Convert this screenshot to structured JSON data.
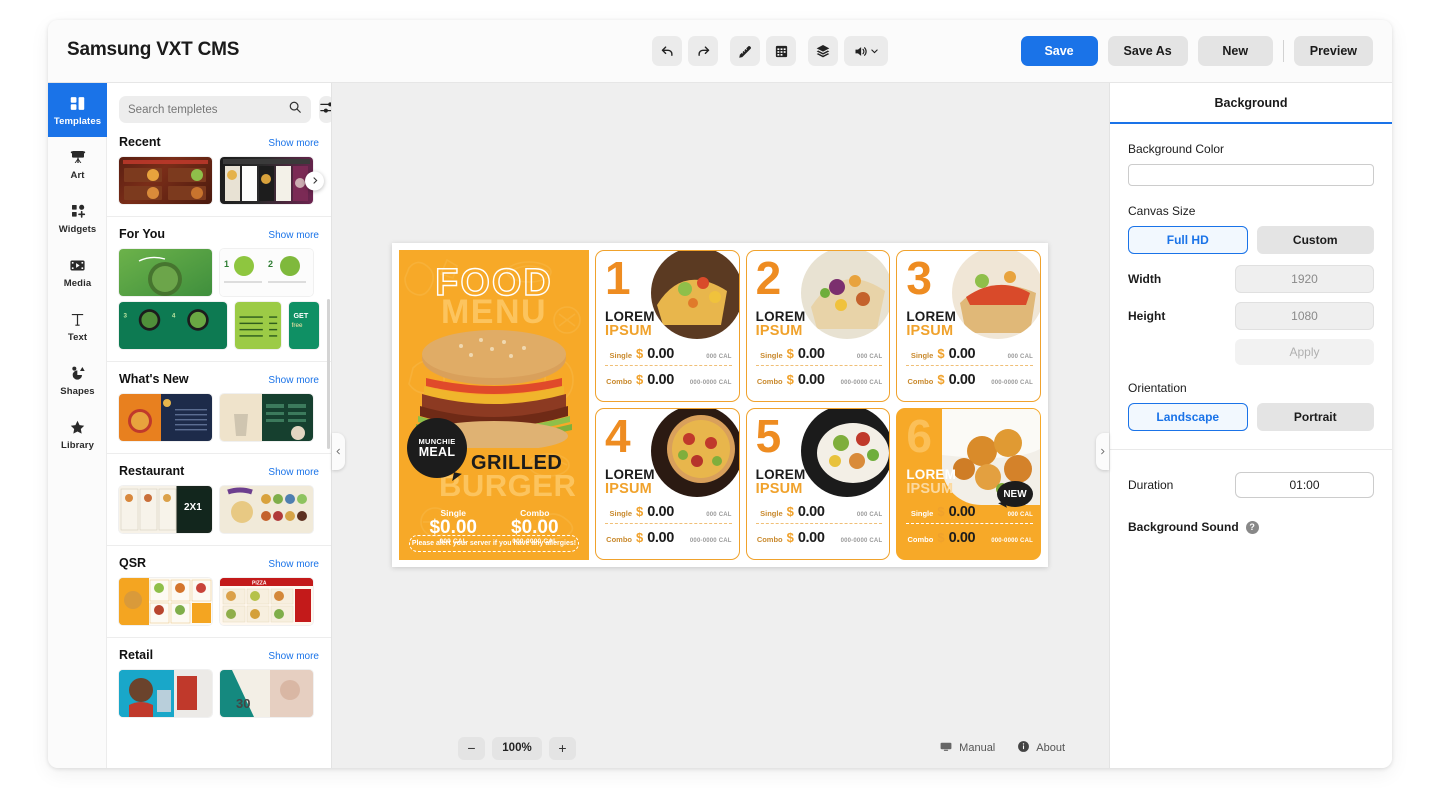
{
  "app": {
    "title": "Samsung VXT CMS"
  },
  "toolbar": {
    "tools": [
      {
        "name": "undo-button",
        "icon": "undo-icon"
      },
      {
        "name": "redo-button",
        "icon": "redo-icon"
      },
      {
        "name": "ruler-button",
        "icon": "ruler-icon"
      },
      {
        "name": "grid-button",
        "icon": "grid-icon"
      },
      {
        "name": "layers-button",
        "icon": "layers-icon"
      },
      {
        "name": "volume-button",
        "icon": "volume-icon"
      }
    ],
    "save_label": "Save",
    "save_as_label": "Save As",
    "new_label": "New",
    "preview_label": "Preview",
    "accent_color": "#1a73e8"
  },
  "rail": {
    "items": [
      {
        "label": "Templates",
        "icon": "templates-icon",
        "active": true
      },
      {
        "label": "Art",
        "icon": "easel-icon",
        "active": false
      },
      {
        "label": "Widgets",
        "icon": "widgets-icon",
        "active": false
      },
      {
        "label": "Media",
        "icon": "media-icon",
        "active": false
      },
      {
        "label": "Text",
        "icon": "text-icon",
        "active": false
      },
      {
        "label": "Shapes",
        "icon": "shapes-icon",
        "active": false
      },
      {
        "label": "Library",
        "icon": "star-icon",
        "active": false
      }
    ]
  },
  "templates": {
    "search_placeholder": "Search templetes",
    "search_value": "",
    "show_more_label": "Show more",
    "sections": [
      {
        "title": "Recent"
      },
      {
        "title": "For You"
      },
      {
        "title": "What's New"
      },
      {
        "title": "Restaurant"
      },
      {
        "title": "QSR"
      },
      {
        "title": "Retail"
      }
    ]
  },
  "canvas": {
    "collapse_left_icon": "chevron-left-icon",
    "collapse_right_icon": "chevron-right-icon",
    "zoom_level": "100%",
    "zoom_out_label": "−",
    "zoom_in_label": "+",
    "manual_label": "Manual",
    "about_label": "About"
  },
  "design": {
    "hero": {
      "title_line1": "FOOD",
      "title_line2": "MENU",
      "badge_line1": "MUNCHIE",
      "badge_line2": "MEAL",
      "item_line1": "GRILLED",
      "item_line2": "BURGER",
      "single_label": "Single",
      "single_price": "$0.00",
      "single_cal": "000 CAL",
      "combo_label": "Combo",
      "combo_price": "$0.00",
      "combo_cal": "000-0000 CAL",
      "allergy_note": "Please alert your server if you have any allergies!",
      "bg_color": "#f7a928"
    },
    "cards": [
      {
        "number": "1",
        "line1": "LOREM",
        "line2": "IPSUM",
        "single_label": "Single",
        "single_price": "0.00",
        "single_cal": "000 CAL",
        "combo_label": "Combo",
        "combo_price": "0.00",
        "combo_cal": "000-0000 CAL",
        "filled": false,
        "badge": ""
      },
      {
        "number": "2",
        "line1": "LOREM",
        "line2": "IPSUM",
        "single_label": "Single",
        "single_price": "0.00",
        "single_cal": "000 CAL",
        "combo_label": "Combo",
        "combo_price": "0.00",
        "combo_cal": "000-0000 CAL",
        "filled": false,
        "badge": ""
      },
      {
        "number": "3",
        "line1": "LOREM",
        "line2": "IPSUM",
        "single_label": "Single",
        "single_price": "0.00",
        "single_cal": "000 CAL",
        "combo_label": "Combo",
        "combo_price": "0.00",
        "combo_cal": "000-0000 CAL",
        "filled": false,
        "badge": ""
      },
      {
        "number": "4",
        "line1": "LOREM",
        "line2": "IPSUM",
        "single_label": "Single",
        "single_price": "0.00",
        "single_cal": "000 CAL",
        "combo_label": "Combo",
        "combo_price": "0.00",
        "combo_cal": "000-0000 CAL",
        "filled": false,
        "badge": ""
      },
      {
        "number": "5",
        "line1": "LOREM",
        "line2": "IPSUM",
        "single_label": "Single",
        "single_price": "0.00",
        "single_cal": "000 CAL",
        "combo_label": "Combo",
        "combo_price": "0.00",
        "combo_cal": "000-0000 CAL",
        "filled": false,
        "badge": ""
      },
      {
        "number": "6",
        "line1": "LOREM",
        "line2": "IPSUM",
        "single_label": "Single",
        "single_price": "0.00",
        "single_cal": "000 CAL",
        "combo_label": "Combo",
        "combo_price": "0.00",
        "combo_cal": "000-0000 CAL",
        "filled": true,
        "badge": "NEW"
      }
    ],
    "dollar_sign": "$"
  },
  "properties": {
    "panel_title": "Background",
    "background_color_label": "Background Color",
    "background_color_value": "",
    "canvas_size_label": "Canvas Size",
    "size_full_hd": "Full HD",
    "size_custom": "Custom",
    "width_label": "Width",
    "width_value": "1920",
    "height_label": "Height",
    "height_value": "1080",
    "apply_label": "Apply",
    "orientation_label": "Orientation",
    "orientation_landscape": "Landscape",
    "orientation_portrait": "Portrait",
    "duration_label": "Duration",
    "duration_value": "01:00",
    "background_sound_label": "Background Sound",
    "help_glyph": "?"
  }
}
